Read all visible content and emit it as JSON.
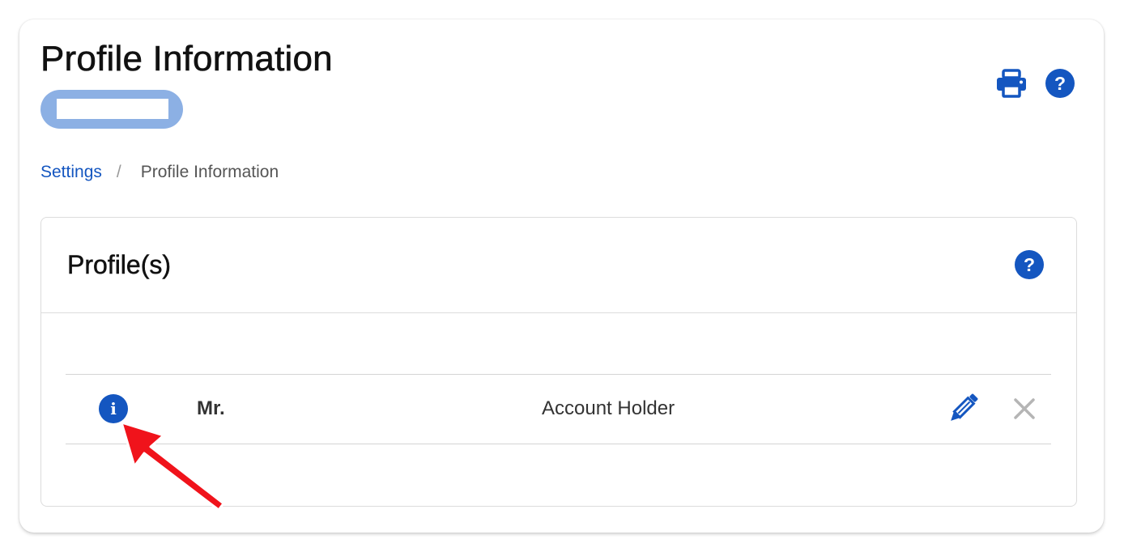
{
  "header": {
    "title": "Profile Information",
    "print_icon": "printer-icon",
    "help_icon": "question-circle-icon"
  },
  "breadcrumb": {
    "link": "Settings",
    "separator": "/",
    "current": "Profile Information"
  },
  "profiles_panel": {
    "title": "Profile(s)",
    "help_icon": "question-circle-icon",
    "rows": [
      {
        "info_icon": "info-circle-icon",
        "info_glyph": "i",
        "salutation": "Mr.",
        "role": "Account Holder",
        "edit_icon": "pencil-icon",
        "delete_icon": "close-icon"
      }
    ]
  },
  "help_glyph": "?",
  "colors": {
    "primary": "#1456c0",
    "pill": "#8cb0e4",
    "annotation": "#f0131b",
    "muted_icon": "#b5b5b5"
  }
}
